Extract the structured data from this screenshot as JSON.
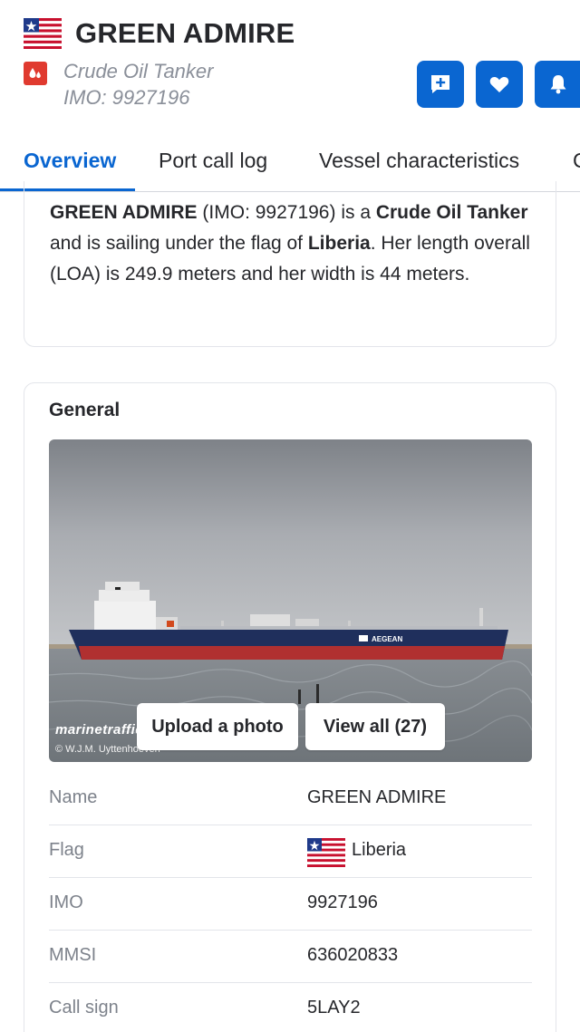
{
  "vessel": {
    "name": "GREEN ADMIRE",
    "type": "Crude Oil Tanker",
    "imo_label": "IMO: 9927196"
  },
  "icons": {
    "flag": "liberia-flag-icon",
    "type": "oil-drop-icon",
    "actions": [
      "add-note-icon",
      "heart-icon",
      "bell-icon"
    ]
  },
  "tabs": [
    "Overview",
    "Port call log",
    "Vessel characteristics",
    "C"
  ],
  "summary": {
    "name": "GREEN ADMIRE",
    "part1": " (IMO: 9927196) is a ",
    "type": "Crude Oil Tanker",
    "part2": " and is sailing under the flag of ",
    "flag": "Liberia",
    "part3": ". Her length overall (LOA) is 249.9 meters and her width is 44 meters."
  },
  "general": {
    "title": "General",
    "photo": {
      "watermark": "marinetraffic",
      "credit": "© W.J.M. Uyttenhoeven",
      "hull_text": "AEGEAN",
      "upload_label": "Upload a photo",
      "view_all_label": "View all (27)"
    },
    "rows": [
      {
        "label": "Name",
        "value": "GREEN ADMIRE"
      },
      {
        "label": "Flag",
        "value": "Liberia"
      },
      {
        "label": "IMO",
        "value": "9927196"
      },
      {
        "label": "MMSI",
        "value": "636020833"
      },
      {
        "label": "Call sign",
        "value": "5LAY2"
      }
    ]
  },
  "colors": {
    "accent": "#0a66d1",
    "type_badge": "#e03a2f",
    "muted_text": "#8a8f99",
    "hull_blue": "#1f2f5c",
    "hull_red": "#b03030"
  }
}
